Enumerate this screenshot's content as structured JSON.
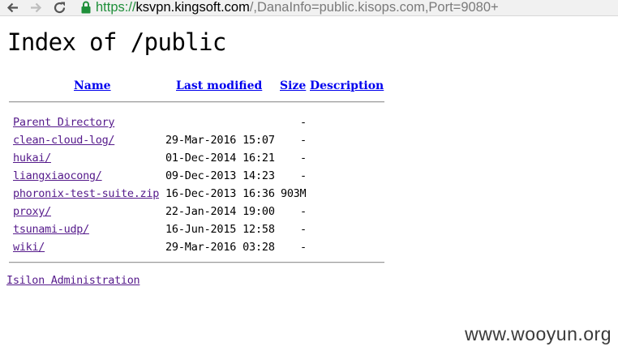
{
  "browser": {
    "url_scheme": "https://",
    "url_host": "ksvpn.kingsoft.com",
    "url_rest": "/,DanaInfo=public.kisops.com,Port=9080+"
  },
  "page": {
    "title": "Index of /public",
    "columns": {
      "name": "Name",
      "last_modified": "Last modified",
      "size": "Size",
      "description": "Description"
    },
    "rows": [
      {
        "name": "Parent Directory",
        "date": "",
        "size": "-"
      },
      {
        "name": "clean-cloud-log/",
        "date": "29-Mar-2016 15:07",
        "size": "-"
      },
      {
        "name": "hukai/",
        "date": "01-Dec-2014 16:21",
        "size": "-"
      },
      {
        "name": "liangxiaocong/",
        "date": "09-Dec-2013 14:23",
        "size": "-"
      },
      {
        "name": "phoronix-test-suite.zip",
        "date": "16-Dec-2013 16:36",
        "size": "903M"
      },
      {
        "name": "proxy/",
        "date": "22-Jan-2014 19:00",
        "size": "-"
      },
      {
        "name": "tsunami-udp/",
        "date": "16-Jun-2015 12:58",
        "size": "-"
      },
      {
        "name": "wiki/",
        "date": "29-Mar-2016 03:28",
        "size": "-"
      }
    ],
    "footer": "Isilon Administration"
  },
  "watermark": "www.wooyun.org"
}
